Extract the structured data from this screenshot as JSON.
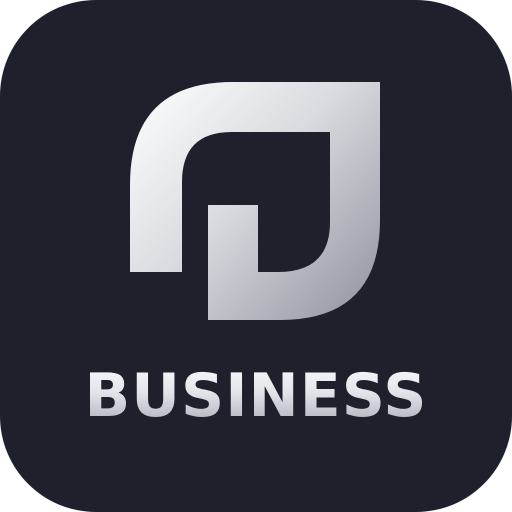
{
  "app_icon": {
    "brand_text": "BUSINESS",
    "logo_icon": "leaf-monogram-icon",
    "colors": {
      "background": "#1e212b",
      "logo_light": "#ffffff",
      "logo_mid": "#d9dbe0",
      "logo_dark": "#8e929c"
    }
  }
}
